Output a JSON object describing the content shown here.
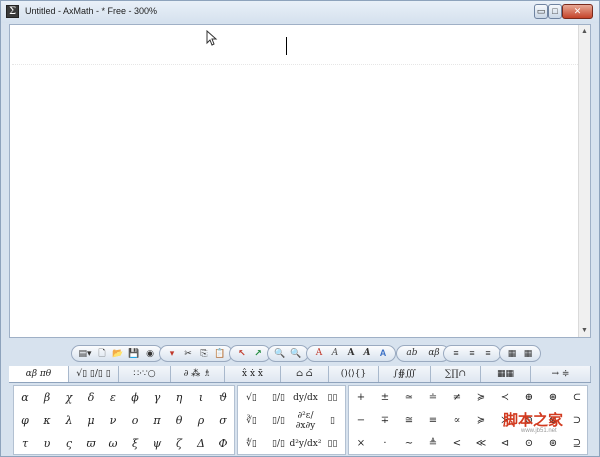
{
  "window": {
    "title": "Untitled - AxMath - * Free - 300%"
  },
  "title_controls": {
    "minimize": "▭",
    "maximize": "□",
    "close": "✕"
  },
  "icons": {
    "app": "app-icon",
    "pointer": "mouse-pointer-icon",
    "scroll_up": "▲",
    "scroll_down": "▼"
  },
  "toolbar": {
    "groups": [
      [
        "▤▾",
        "🗋",
        "📂",
        "💾",
        "◉"
      ],
      [
        "▾",
        "✂",
        "⎘",
        "📋"
      ],
      [
        "↖",
        "↗"
      ],
      [
        "🔍",
        "🔍"
      ],
      [
        "A",
        "A",
        "A",
        "A",
        "A"
      ],
      [
        "ab",
        "αβ"
      ],
      [
        "≡",
        "≡",
        "≡"
      ],
      [
        "▦",
        "▦"
      ]
    ]
  },
  "tabs": [
    "αβ πθ",
    "√▯ ▯/▯ ▯",
    "∷·∵○",
    "∂ ⁂ ♗",
    "x̂ ẋ x̄",
    "⌂ ⌂̄",
    "()⟨⟩{}",
    "∫∯∭",
    "∑∏∩",
    "▦▦",
    "→ ≑"
  ],
  "greek": [
    [
      "α",
      "β",
      "χ",
      "δ",
      "ε",
      "ϕ",
      "γ",
      "η",
      "ι",
      "ϑ"
    ],
    [
      "φ",
      "κ",
      "λ",
      "μ",
      "ν",
      "ο",
      "π",
      "θ",
      "ρ",
      "σ"
    ],
    [
      "τ",
      "υ",
      "ς",
      "ϖ",
      "ω",
      "ξ",
      "ψ",
      "ζ",
      "Δ",
      "Φ"
    ]
  ],
  "templates": [
    [
      "√▯",
      "▯/▯",
      "dy/dx",
      "▯▯"
    ],
    [
      "∛▯",
      "▯/▯",
      "∂²ε/∂x∂y",
      "▯"
    ],
    [
      "∜▯",
      "▯/▯",
      "d²y/dx²",
      "▯▯"
    ]
  ],
  "operators": [
    [
      "+",
      "±",
      "≃",
      "≐",
      "≠",
      "≽",
      "≺",
      "⊕",
      "⊛",
      "⊂"
    ],
    [
      "−",
      "∓",
      "≅",
      "≡",
      "∝",
      "≽",
      "≻",
      "⊝",
      "⊗",
      "⊃"
    ],
    [
      "×",
      "·",
      "∼",
      "≜",
      "<",
      "≪",
      "⊲",
      "⊙",
      "⊚",
      "⊇"
    ]
  ],
  "watermark": {
    "text": "脚本之家",
    "url": "www.jb51.net"
  }
}
